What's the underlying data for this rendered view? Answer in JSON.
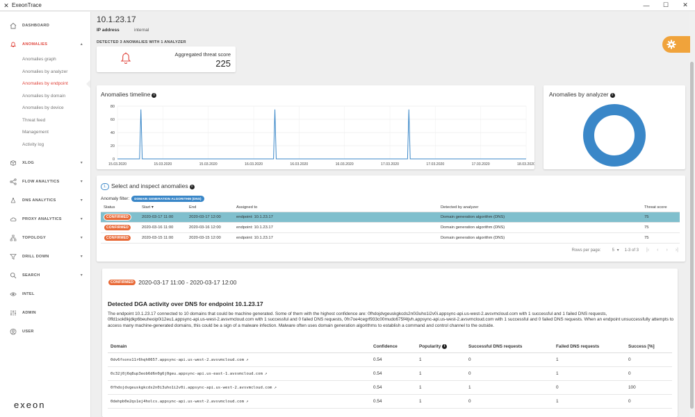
{
  "window": {
    "title": "ExeonTrace",
    "controls": [
      "—",
      "☐",
      "✕"
    ]
  },
  "sidebar": {
    "nav": [
      {
        "key": "dashboard",
        "label": "DASHBOARD",
        "icon": "home-icon",
        "chevron": false
      },
      {
        "key": "anomalies",
        "label": "ANOMALIES",
        "icon": "bell-icon",
        "chevron": true,
        "expanded": true
      },
      {
        "key": "xlog",
        "label": "XLOG",
        "icon": "box-icon",
        "chevron": true
      },
      {
        "key": "flow",
        "label": "FLOW ANALYTICS",
        "icon": "share-icon",
        "chevron": true
      },
      {
        "key": "dns",
        "label": "DNS ANALYTICS",
        "icon": "network-icon",
        "chevron": true
      },
      {
        "key": "proxy",
        "label": "PROXY ANALYTICS",
        "icon": "cloud-icon",
        "chevron": true
      },
      {
        "key": "topology",
        "label": "TOPOLOGY",
        "icon": "hierarchy-icon",
        "chevron": true
      },
      {
        "key": "drilldown",
        "label": "DRILL DOWN",
        "icon": "filter-icon",
        "chevron": true
      },
      {
        "key": "search",
        "label": "SEARCH",
        "icon": "search-icon",
        "chevron": true
      },
      {
        "key": "intel",
        "label": "INTEL",
        "icon": "eye-icon",
        "chevron": false
      },
      {
        "key": "admin",
        "label": "ADMIN",
        "icon": "sliders-icon",
        "chevron": false
      },
      {
        "key": "user",
        "label": "USER",
        "icon": "user-icon",
        "chevron": false
      }
    ],
    "anomalies_sub": [
      {
        "label": "Anomalies graph"
      },
      {
        "label": "Anomalies by analyzer"
      },
      {
        "label": "Anomalies by endpoint",
        "active": true
      },
      {
        "label": "Anomalies by domain"
      },
      {
        "label": "Anomalies by device"
      },
      {
        "label": "Threat feed"
      },
      {
        "label": "Management"
      },
      {
        "label": "Activity log"
      }
    ],
    "logo": "exeon"
  },
  "header": {
    "ip": "10.1.23.17",
    "ip_label": "IP address",
    "ip_value": "internal",
    "detected": "DETECTED 3 ANOMALIES WITH 1 ANALYZER"
  },
  "score": {
    "label": "Aggregated threat score",
    "value": "225"
  },
  "timeline": {
    "title": "Anomalies timeline"
  },
  "donut": {
    "title": "Anomalies by analyzer"
  },
  "chart_data": [
    {
      "type": "line",
      "title": "Anomalies timeline",
      "x_tick_labels": [
        "15.03.2020",
        "15.03.2020",
        "15.03.2020",
        "16.03.2020",
        "16.03.2020",
        "16.03.2020",
        "17.03.2020",
        "17.03.2020",
        "17.03.2020",
        "18.03.2020"
      ],
      "y_ticks": [
        0,
        20,
        40,
        60,
        80
      ],
      "ylim": [
        0,
        80
      ],
      "grid": true,
      "series": [
        {
          "color": "#3a87c8",
          "x": [
            0,
            0.165,
            0.175,
            0.185,
            1.165,
            1.175,
            1.185,
            2.165,
            2.175,
            2.185,
            3.05
          ],
          "y": [
            0,
            0,
            75,
            0,
            0,
            75,
            0,
            0,
            75,
            0,
            0
          ]
        }
      ],
      "xlim": [
        0,
        3.05
      ]
    },
    {
      "type": "pie",
      "title": "Anomalies by analyzer",
      "donut": true,
      "slices": [
        {
          "label": "Domain generation algorithm (DNS)",
          "value": 3,
          "color": "#3a87c8"
        }
      ]
    }
  ],
  "select": {
    "step": "1.",
    "title": "Select and inspect anomalies",
    "filter_label": "Anomaly filter:",
    "filter_chip": "DOMAIN GENERATION ALGORITHM (DNS)",
    "columns": [
      "Status",
      "Start ▾",
      "End",
      "Assigned to",
      "Detected by analyzer",
      "Threat score"
    ],
    "rows": [
      {
        "status": "CONFIRMED",
        "start": "2020-03-17 11:00",
        "end": "2020-03-17 12:00",
        "assigned": "endpoint: 10.1.23.17",
        "analyzer": "Domain generation algorithm (DNS)",
        "score": "75",
        "selected": true
      },
      {
        "status": "CONFIRMED",
        "start": "2020-03-16 11:00",
        "end": "2020-03-16 12:00",
        "assigned": "endpoint: 10.1.23.17",
        "analyzer": "Domain generation algorithm (DNS)",
        "score": "75"
      },
      {
        "status": "CONFIRMED",
        "start": "2020-03-15 11:00",
        "end": "2020-03-15 12:00",
        "assigned": "endpoint: 10.1.23.17",
        "analyzer": "Domain generation algorithm (DNS)",
        "score": "75"
      }
    ],
    "pager": {
      "rows_per_page_label": "Rows per page:",
      "rows_per_page": "5",
      "range": "1-3 of 3"
    }
  },
  "detail": {
    "status": "CONFIRMED",
    "range": "2020-03-17 11:00 - 2020-03-17 12:00",
    "title": "Detected DGA activity over DNS for endpoint 10.1.23.17",
    "description": "The endpoint 10.1.23.17 connected to 10 domains that could be machine generated. Some of them with the highest confidence are: 0fhdojdvgeuskgkcds2n0i3uho1i2v0i.appsync-api.us-west-2.avsvmcloud.com with 1 successful and 1 failed DNS requests, 0ffd1sok8kjdkp6beuheoip0i12eu1.appsync-api.us-west-2.avsvmcloud.com with 1 successful and 0 failed DNS requests, 0fn7oe4cegrf933c00mudo675f4tjvh.appsync-api.us-west-2.avsvmcloud.com with 1 successful and 0 failed DNS requests. When an endpoint unsuccessfully attempts to access many machine-generated domains, this could be a sign of a malware infection. Malware often uses domain generation algorithms to establish a command and control channel to the outside.",
    "columns": [
      "Domain",
      "Confidence",
      "Popularity",
      "Successful DNS requests",
      "Failed DNS requests",
      "Success [%]"
    ],
    "rows": [
      {
        "domain": "0dv6fsons11r6hqh0657.appsync-api.us-west-2.avsvmcloud.com",
        "confidence": "0.54",
        "popularity": "1",
        "success": "0",
        "failed": "1",
        "pct": "0"
      },
      {
        "domain": "0c32j0j6q8up3eob6d6n0g6j0geu.appsync-api.us-east-1.avsvmcloud.com",
        "confidence": "0.54",
        "popularity": "1",
        "success": "0",
        "failed": "1",
        "pct": "0"
      },
      {
        "domain": "0fhdojdvgeuskgkcds2n0i3uho1i2v0i.appsync-api.us-west-2.avsvmcloud.com",
        "confidence": "0.54",
        "popularity": "1",
        "success": "1",
        "failed": "0",
        "pct": "100"
      },
      {
        "domain": "0dehpb0e2qs1ej4holcs.appsync-api.us-west-2.avsvmcloud.com",
        "confidence": "0.54",
        "popularity": "1",
        "success": "0",
        "failed": "1",
        "pct": "0"
      }
    ]
  },
  "colors": {
    "accent_red": "#e0453c",
    "primary_blue": "#3a87c8",
    "badge_orange": "#e86a38",
    "selected_row": "#80bfcd",
    "settings_tab": "#f0a33b"
  }
}
